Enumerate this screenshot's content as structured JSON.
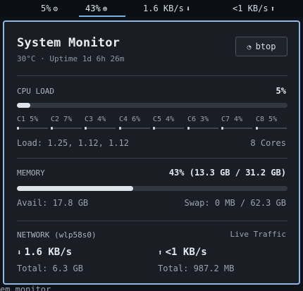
{
  "topbar": {
    "brightness": "5%",
    "volume": "43%",
    "download": "1.6 KB/s",
    "upload": "<1 KB/s",
    "icons": {
      "brightness": "gear-sun-icon",
      "volume": "circle-dot-icon",
      "download": "download-icon",
      "upload": "upload-icon"
    }
  },
  "panel": {
    "title": "System Monitor",
    "subtitle": "30°C · Uptime 1d 6h 26m",
    "btop_button": "btop"
  },
  "cpu": {
    "label": "CPU LOAD",
    "value": "5%",
    "percent": 5,
    "cores": [
      {
        "label": "C1 5%",
        "percent": 5
      },
      {
        "label": "C2 7%",
        "percent": 7
      },
      {
        "label": "C3 4%",
        "percent": 4
      },
      {
        "label": "C4 6%",
        "percent": 6
      },
      {
        "label": "C5 4%",
        "percent": 4
      },
      {
        "label": "C6 3%",
        "percent": 3
      },
      {
        "label": "C7 4%",
        "percent": 4
      },
      {
        "label": "C8 5%",
        "percent": 5
      }
    ],
    "load": "Load: 1.25, 1.12, 1.12",
    "cores_count": "8 Cores"
  },
  "memory": {
    "label": "MEMORY",
    "value": "43% (13.3 GB / 31.2 GB)",
    "percent": 43,
    "avail": "Avail: 17.8 GB",
    "swap": "Swap: 0 MB / 62.3 GB"
  },
  "network": {
    "label": "NETWORK (wlp58s0)",
    "live": "Live Traffic",
    "down_rate": "1.6 KB/s",
    "down_total": "Total: 6.3 GB",
    "up_rate": "<1 KB/s",
    "up_total": "Total: 987.2 MB"
  },
  "background_text": "em monitor"
}
